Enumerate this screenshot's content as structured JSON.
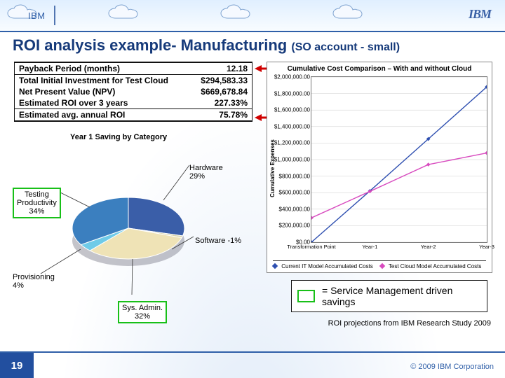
{
  "brand": {
    "text": "IBM",
    "logo": "IBM"
  },
  "title": {
    "main": "ROI analysis example- Manufacturing",
    "sub": "(SO account - small)"
  },
  "metrics": [
    {
      "label": "Payback Period (months)",
      "value": "12.18",
      "highlight": true
    },
    {
      "label": "Total Initial Investment for Test Cloud",
      "value": "$294,583.33",
      "highlight": false
    },
    {
      "label": "Net Present Value (NPV)",
      "value": "$669,678.84",
      "highlight": false
    },
    {
      "label": "Estimated ROI over 3 years",
      "value": "227.33%",
      "highlight": false
    },
    {
      "label": "Estimated avg. annual ROI",
      "value": "75.78%",
      "highlight": true
    }
  ],
  "pie_title": "Year 1 Saving by Category",
  "chart_data": [
    {
      "type": "pie",
      "title": "Year 1 Saving by Category",
      "slices": [
        {
          "name": "Hardware",
          "value": 29,
          "color": "#3a5ea8"
        },
        {
          "name": "Software",
          "value": -1,
          "color": "#d9d4a8"
        },
        {
          "name": "Sys. Admin.",
          "value": 32,
          "color": "#efe3b6"
        },
        {
          "name": "Provisioning",
          "value": 4,
          "color": "#6fcbe8"
        },
        {
          "name": "Testing Productivity",
          "value": 34,
          "color": "#3b7fbf"
        }
      ],
      "green_highlight": [
        "Testing Productivity",
        "Sys. Admin."
      ]
    },
    {
      "type": "line",
      "title": "Cumulative Cost Comparison – With and without Cloud",
      "xlabel": "",
      "ylabel": "Cumulative Expenses",
      "x": [
        "Transformation Point",
        "Year-1",
        "Year-2",
        "Year-3"
      ],
      "ylim": [
        0,
        2000000
      ],
      "yticks": [
        0,
        200000,
        400000,
        600000,
        800000,
        1000000,
        1200000,
        1400000,
        1600000,
        1800000,
        2000000
      ],
      "ytick_labels": [
        "$0.00",
        "$200,000.00",
        "$400,000.00",
        "$600,000.00",
        "$800,000.00",
        "$1,000,000.00",
        "$1,200,000.00",
        "$1,400,000.00",
        "$1,600,000.00",
        "$1,800,000.00",
        "$2,000,000.00"
      ],
      "series": [
        {
          "name": "Current IT Model Accumulated Costs",
          "color": "#2e4fb0",
          "values": [
            0,
            620000,
            1250000,
            1880000
          ]
        },
        {
          "name": "Test Cloud Model Accumulated Costs",
          "color": "#d84bbf",
          "values": [
            295000,
            615000,
            940000,
            1080000
          ]
        }
      ]
    }
  ],
  "callout": "= Service Management driven savings",
  "source": "ROI projections from IBM Research Study 2009",
  "page": "19",
  "copyright": "© 2009 IBM Corporation",
  "labels": {
    "hardware": "Hardware\n29%",
    "software": "Software -1%",
    "sysadmin": "Sys. Admin.\n32%",
    "provisioning": "Provisioning\n4%",
    "testing": "Testing\nProductivity\n34%"
  }
}
